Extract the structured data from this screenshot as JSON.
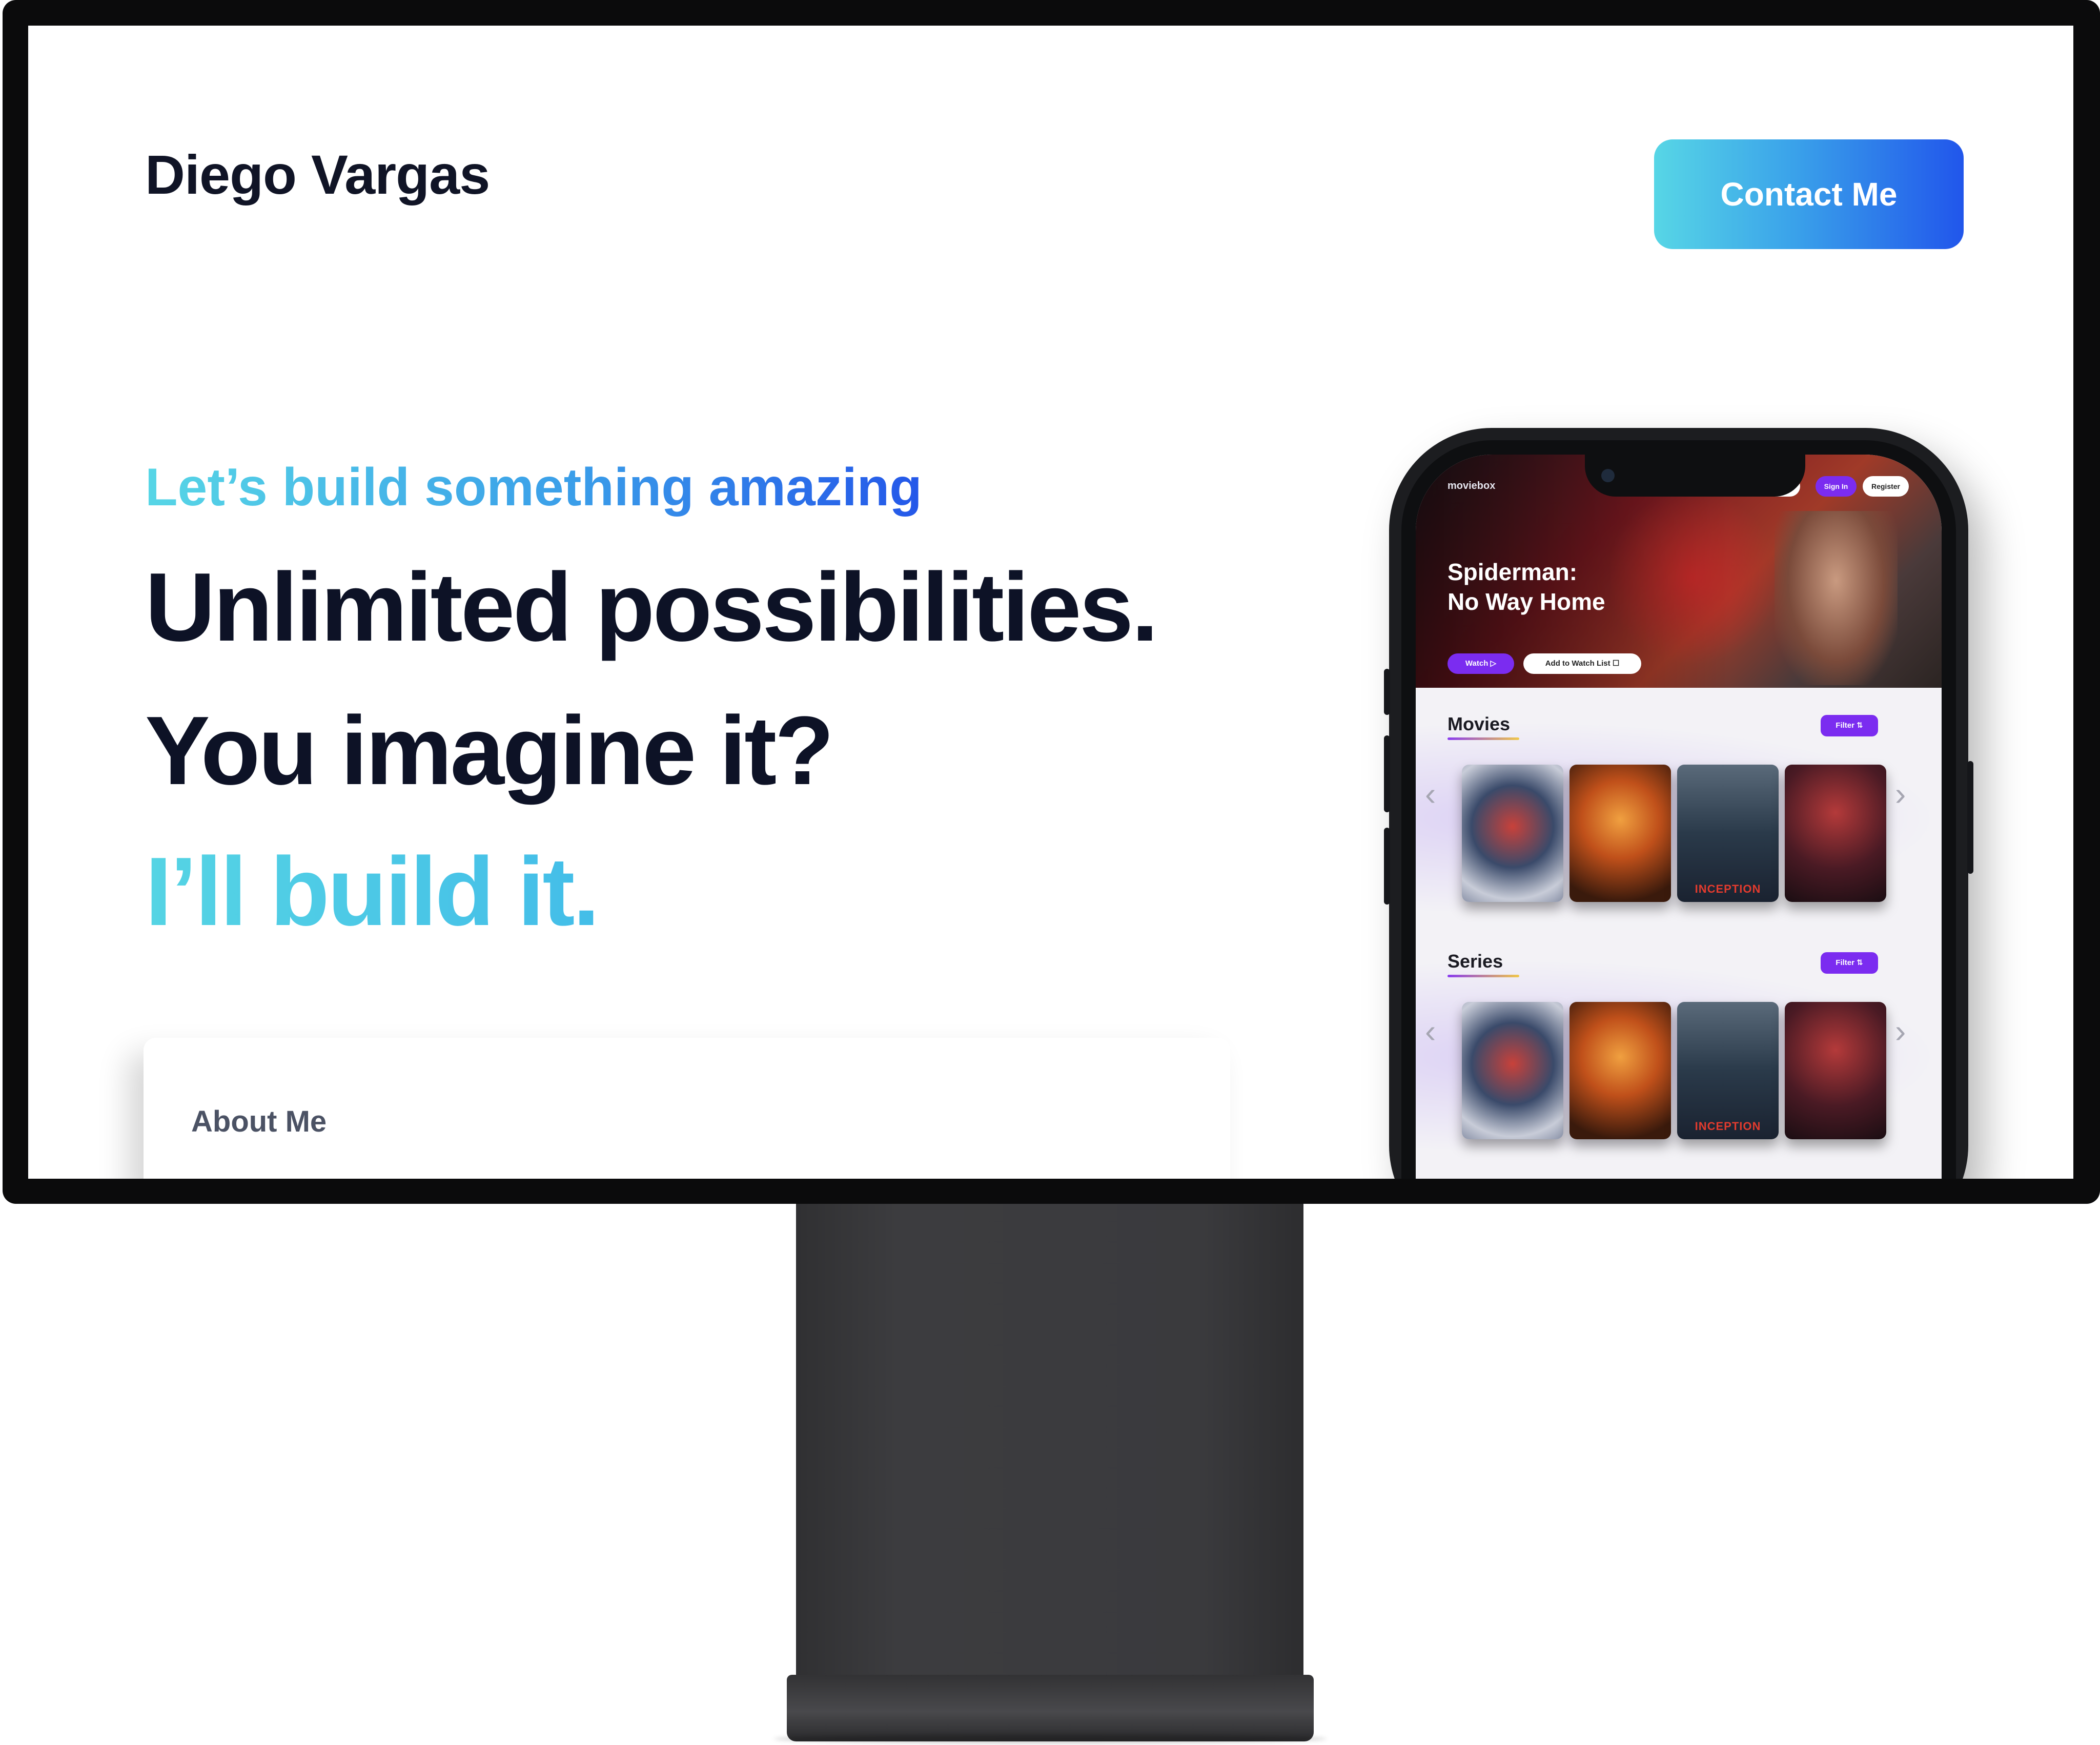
{
  "site": {
    "name": "Diego Vargas",
    "contact_button": "Contact Me",
    "eyebrow": "Let’s build something amazing",
    "headline_1": "Unlimited possibilities.",
    "headline_2": "You imagine it?",
    "headline_3": "I’ll build it.",
    "about_label": "About Me"
  },
  "colors": {
    "accent_cyan": "#57d6e6",
    "accent_blue": "#2156eb",
    "text_dark": "#0d1226",
    "app_purple": "#7b2cf0"
  },
  "phone_app": {
    "logo": "moviebox",
    "nav": {
      "search": "",
      "sign_in": "Sign In",
      "register": "Register"
    },
    "hero": {
      "title": "Spiderman:\nNo Way Home",
      "watch_button": "Watch ▷",
      "watchlist_button": "Add to Watch List ☐"
    },
    "sections": [
      {
        "title": "Movies",
        "filter": "Filter ⇅",
        "posters": [
          "",
          "",
          "INCEPTION",
          ""
        ]
      },
      {
        "title": "Series",
        "filter": "Filter ⇅",
        "posters": [
          "",
          "",
          "INCEPTION",
          ""
        ]
      }
    ]
  }
}
